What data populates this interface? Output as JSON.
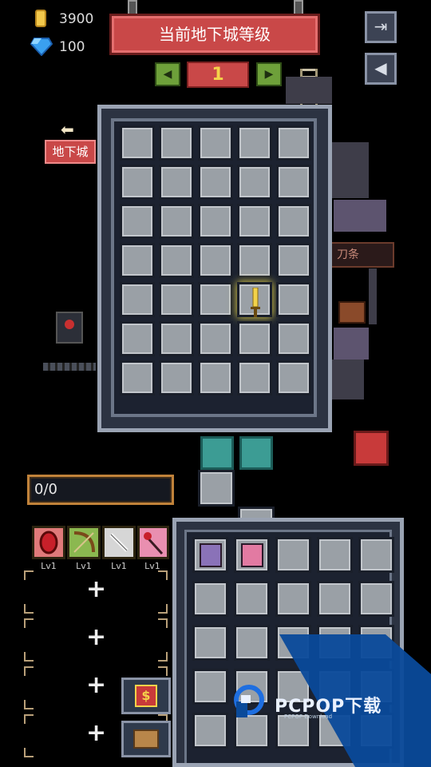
{
  "hud": {
    "coins": "3900",
    "gems": "100"
  },
  "banner": {
    "title": "当前地下城等级"
  },
  "level": {
    "value": "1",
    "prev_icon": "left-arrow-icon",
    "next_icon": "right-arrow-icon"
  },
  "side_buttons": {
    "exit_icon": "exit-icon",
    "sound_icon": "sound-icon"
  },
  "dungeon": {
    "button_label": "地下城"
  },
  "board": {
    "rows": 7,
    "cols": 5,
    "item": "sword"
  },
  "right_sign": {
    "text": "刀条"
  },
  "progress": {
    "text": "0/0"
  },
  "skills": [
    {
      "icon": "red-shield-icon",
      "level": "Lv1",
      "color": "#e07a7a"
    },
    {
      "icon": "crossbow-icon",
      "level": "Lv1",
      "color": "#8bb850"
    },
    {
      "icon": "sword-icon",
      "level": "Lv1",
      "color": "#d6d6d6"
    },
    {
      "icon": "staff-icon",
      "level": "Lv1",
      "color": "#e98fb0"
    }
  ],
  "empty_slots": [
    "+",
    "+",
    "+",
    "+"
  ],
  "shop": {
    "icon": "dollar-icon",
    "label": "$"
  },
  "inventory": {
    "items": [
      "purple-book-icon",
      "pink-book-icon"
    ]
  },
  "watermark": {
    "text": "PCPOP下载",
    "sub": "PCPOP Download"
  }
}
